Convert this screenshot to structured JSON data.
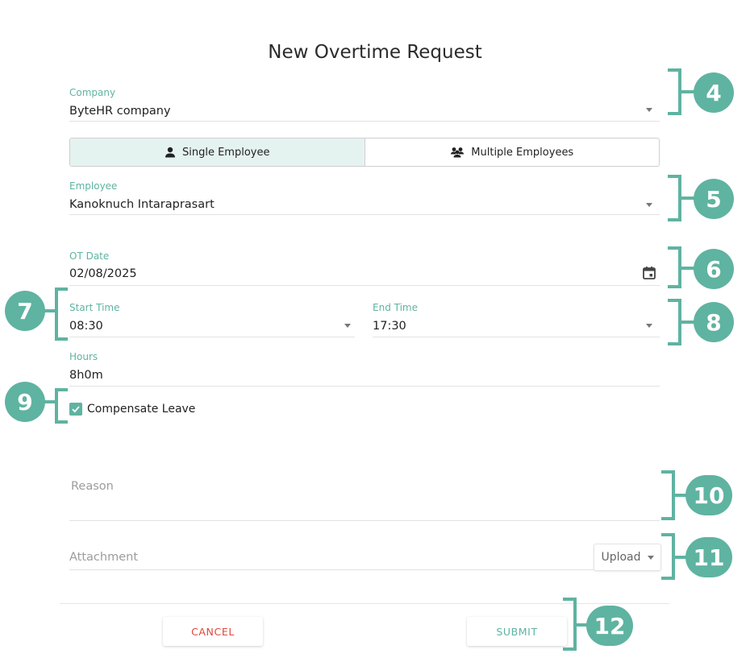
{
  "title": "New Overtime Request",
  "company": {
    "label": "Company",
    "value": "ByteHR company"
  },
  "mode_toggle": {
    "single_label": "Single Employee",
    "multiple_label": "Multiple Employees",
    "selected": "single"
  },
  "employee": {
    "label": "Employee",
    "value": "Kanoknuch Intaraprasart"
  },
  "ot_date": {
    "label": "OT Date",
    "value": "02/08/2025"
  },
  "start_time": {
    "label": "Start Time",
    "value": "08:30"
  },
  "end_time": {
    "label": "End Time",
    "value": "17:30"
  },
  "hours": {
    "label": "Hours",
    "value": "8h0m"
  },
  "compensate_leave": {
    "label": "Compensate Leave",
    "checked": true
  },
  "reason": {
    "placeholder": "Reason"
  },
  "attachment": {
    "placeholder": "Attachment",
    "upload_label": "Upload"
  },
  "actions": {
    "cancel_label": "CANCEL",
    "submit_label": "SUBMIT"
  },
  "annotations": {
    "n4": "4",
    "n5": "5",
    "n6": "6",
    "n7": "7",
    "n8": "8",
    "n9": "9",
    "n10": "10",
    "n11": "11",
    "n12": "12"
  },
  "colors": {
    "accent": "#5fb3a1",
    "danger": "#e0463c",
    "active_tab_bg": "#e5f3f0"
  }
}
